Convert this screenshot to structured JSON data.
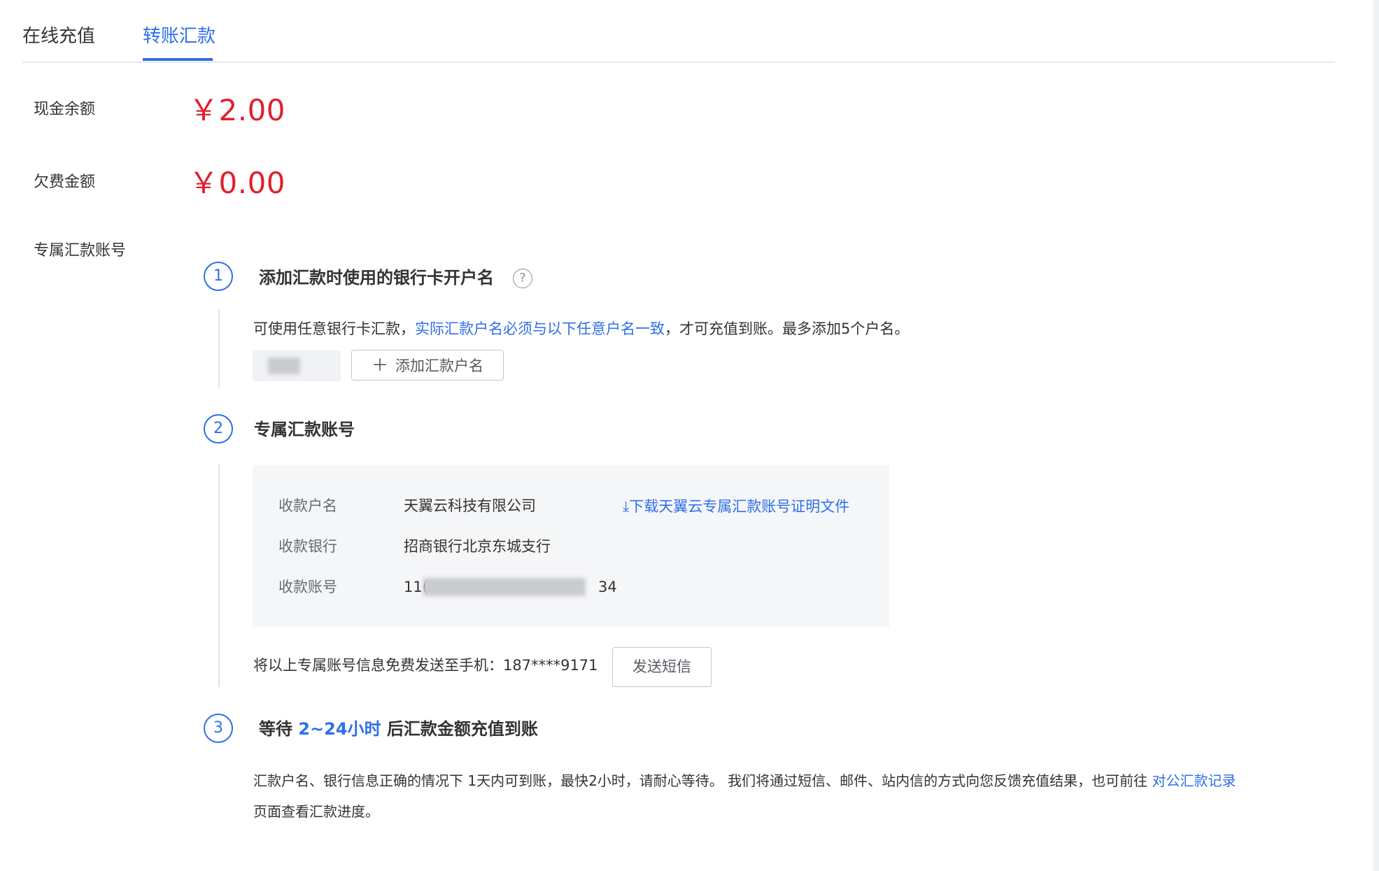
{
  "tabs": [
    {
      "label": "在线充值",
      "active": false
    },
    {
      "label": "转账汇款",
      "active": true
    }
  ],
  "balance": {
    "cash_label": "现金余额",
    "cash_amount": "￥2.00",
    "debt_label": "欠费金额",
    "debt_amount": "￥0.00",
    "account_section_label": "专属汇款账号"
  },
  "step1": {
    "number": "1",
    "title": "添加汇款时使用的银行卡开户名",
    "help_icon": "?",
    "desc_prefix": "可使用任意银行卡汇款，",
    "desc_link": "实际汇款户名必须与以下任意户名一致",
    "desc_suffix": "，才可充值到账。最多添加5个户名。",
    "add_button_label": "添加汇款户名"
  },
  "step2": {
    "number": "2",
    "title": "专属汇款账号",
    "payee_label": "收款户名",
    "payee_value": "天翼云科技有限公司",
    "bank_label": "收款银行",
    "bank_value": "招商银行北京东城支行",
    "account_label": "收款账号",
    "account_prefix": "11(",
    "account_suffix": "34",
    "download_link": "下载天翼云专属汇款账号证明文件",
    "sms_text": "将以上专属账号信息免费发送至手机：187****9171",
    "sms_button": "发送短信"
  },
  "step3": {
    "number": "3",
    "title_prefix": "等待",
    "title_highlight": "2~24小时",
    "title_suffix": "后汇款金额充值到账",
    "desc_line1": "汇款户名、银行信息正确的情况下 1天内可到账，最快2小时，请耐心等待。 我们将通过短信、邮件、站内信的方式向您反馈充值结果，也可前往",
    "desc_link": "对公汇款记录",
    "desc_line2": "页面查看汇款进度。"
  },
  "colors": {
    "accent": "#2e6fe8",
    "amount_red": "#e0202e"
  }
}
